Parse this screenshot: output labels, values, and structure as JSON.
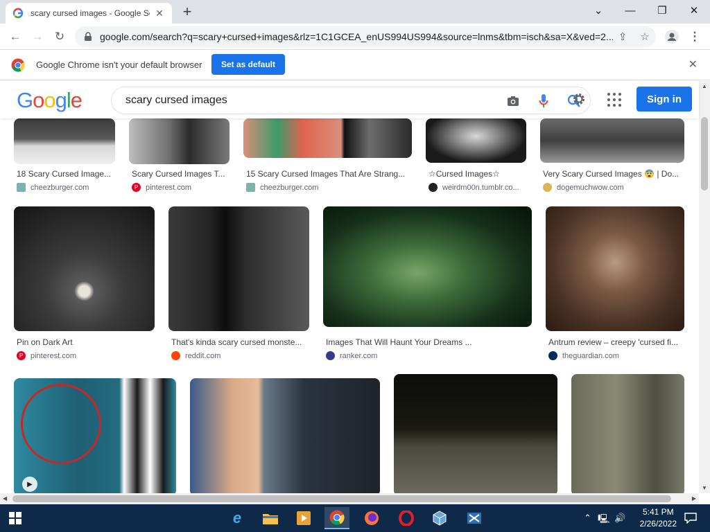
{
  "browser": {
    "tab_title": "scary cursed images - Google Se",
    "url": "google.com/search?q=scary+cursed+images&rlz=1C1GCEA_enUS994US994&source=lnms&tbm=isch&sa=X&ved=2...",
    "infobar_message": "Google Chrome isn't your default browser",
    "set_default_label": "Set as default"
  },
  "google": {
    "logo": [
      "G",
      "o",
      "o",
      "g",
      "l",
      "e"
    ],
    "logo_colors": [
      "#4285f4",
      "#ea4335",
      "#fbbc05",
      "#4285f4",
      "#34a853",
      "#ea4335"
    ],
    "query": "scary cursed images",
    "sign_in_label": "Sign in"
  },
  "results": {
    "row1": [
      {
        "caption": "18 Scary Cursed Image...",
        "source": "cheezburger.com",
        "icon": "cheezburger-icon",
        "icon_color": "#7fb2a8"
      },
      {
        "caption": "Scary Cursed Images T...",
        "source": "pinterest.com",
        "icon": "pinterest-icon",
        "icon_color": "#e60023"
      },
      {
        "caption": "15 Scary Cursed Images That Are Strang...",
        "source": "cheezburger.com",
        "icon": "cheezburger-icon",
        "icon_color": "#7fb2a8"
      },
      {
        "caption": "☆Cursed Images☆",
        "source": "weirdm00n.tumblr.co...",
        "icon": "tumblr-icon",
        "icon_color": "#222222"
      },
      {
        "caption": "Very Scary Cursed Images 😨 | Do...",
        "source": "dogemuchwow.com",
        "icon": "doge-icon",
        "icon_color": "#d9b45a"
      }
    ],
    "row2": [
      {
        "caption": "Pin on Dark Art",
        "source": "pinterest.com",
        "icon": "pinterest-icon",
        "icon_color": "#e60023"
      },
      {
        "caption": "That's kinda scary cursed monste...",
        "source": "reddit.com",
        "icon": "reddit-icon",
        "icon_color": "#ff4500"
      },
      {
        "caption": "Images That Will Haunt Your Dreams ...",
        "source": "ranker.com",
        "icon": "ranker-icon",
        "icon_color": "#3a3a8c"
      },
      {
        "caption": "Antrum review – creepy 'cursed fi...",
        "source": "theguardian.com",
        "icon": "guardian-icon",
        "icon_color": "#052962"
      }
    ]
  },
  "taskbar": {
    "time": "5:41 PM",
    "date": "2/26/2022"
  }
}
